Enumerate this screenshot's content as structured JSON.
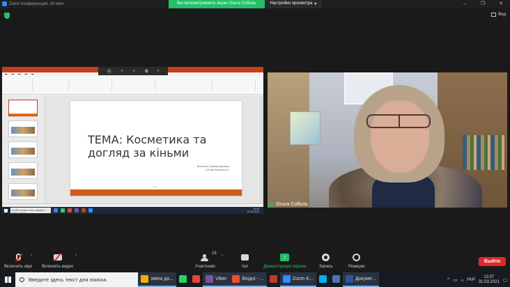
{
  "titlebar": {
    "title": "Zoom Конференция, 40 мин",
    "share_banner": "Вы просматриваете экран Ольга Соболь",
    "view_settings": "Настройки просмотра",
    "view_button": "Вид"
  },
  "shared_screen": {
    "slide_title": "ТЕМА: Косметика та догляд за кіньми",
    "slide_subtitle_line1": "Виконала: Грамова Варвара",
    "slide_subtitle_line2": "6-Б зав Косметики Б.",
    "slide_page": "1911",
    "inner_search_placeholder": "Чтобы начать поиск, введите здесь запрос",
    "inner_time": "13:36",
    "inner_date": "31.03.2021"
  },
  "video": {
    "participant_name": "Ольга Соболь"
  },
  "toolbar": {
    "mute_label": "Включить звук",
    "video_label": "Включить видео",
    "participants_label": "Участники",
    "participants_count": "16",
    "chat_label": "Чат",
    "share_label": "Демонстрация экрана",
    "record_label": "Запись",
    "reactions_label": "Реакции",
    "leave_label": "Выйти"
  },
  "taskbar": {
    "search_placeholder": "Введите здесь текст для поиска",
    "apps": [
      {
        "label": "зміни до...",
        "color": "#f0b000"
      },
      {
        "label": "",
        "color": "#25d366"
      },
      {
        "label": "",
        "color": "#ea4335"
      },
      {
        "label": "Viber",
        "color": "#7b519d"
      },
      {
        "label": "Вхідні - ...",
        "color": "#e8502f"
      },
      {
        "label": "",
        "color": "#c0392b"
      },
      {
        "label": "Zoom K...",
        "color": "#2d8cff"
      },
      {
        "label": "",
        "color": "#00aff0"
      },
      {
        "label": "",
        "color": "#4a74b5"
      },
      {
        "label": "Докуме...",
        "color": "#2b579a"
      }
    ],
    "language": "УКР",
    "time": "13:37",
    "date": "31.03.2021"
  },
  "colors": {
    "accent_green": "#23c069",
    "leave_red": "#e02828",
    "ppt_orange": "#c43e1c"
  }
}
